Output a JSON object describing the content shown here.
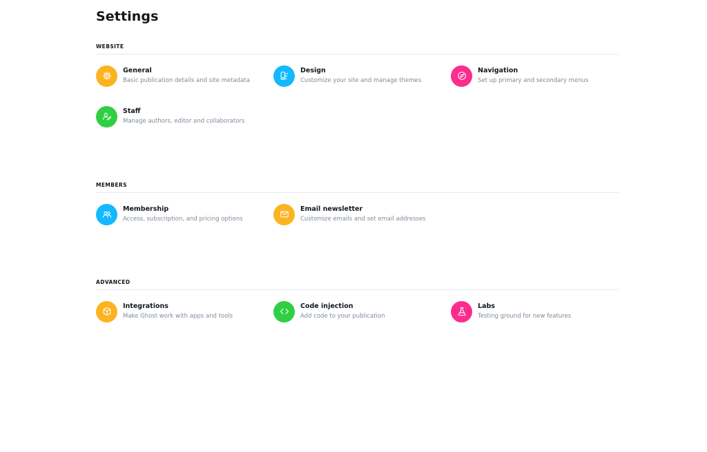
{
  "page": {
    "title": "Settings"
  },
  "sections": [
    {
      "title": "Website",
      "items": [
        {
          "title": "General",
          "desc": "Basic publication details and site metadata",
          "icon": "gear-icon",
          "color": "#fcb322"
        },
        {
          "title": "Design",
          "desc": "Customize your site and manage themes",
          "icon": "paintbrush-icon",
          "color": "#14b8ff"
        },
        {
          "title": "Navigation",
          "desc": "Set up primary and secondary menus",
          "icon": "compass-icon",
          "color": "#fb2d8d"
        },
        {
          "title": "Staff",
          "desc": "Manage authors, editor and collaborators",
          "icon": "user-edit-icon",
          "color": "#30cf43"
        }
      ]
    },
    {
      "title": "Members",
      "items": [
        {
          "title": "Membership",
          "desc": "Access, subscription, and pricing options",
          "icon": "users-icon",
          "color": "#14b8ff"
        },
        {
          "title": "Email newsletter",
          "desc": "Customize emails and set email addresses",
          "icon": "envelope-icon",
          "color": "#fcb322"
        }
      ]
    },
    {
      "title": "Advanced",
      "items": [
        {
          "title": "Integrations",
          "desc": "Make Ghost work with apps and tools",
          "icon": "box-icon",
          "color": "#fcb322"
        },
        {
          "title": "Code injection",
          "desc": "Add code to your publication",
          "icon": "code-icon",
          "color": "#30cf43"
        },
        {
          "title": "Labs",
          "desc": "Testing ground for new features",
          "icon": "flask-icon",
          "color": "#fb2d8d"
        }
      ]
    }
  ]
}
